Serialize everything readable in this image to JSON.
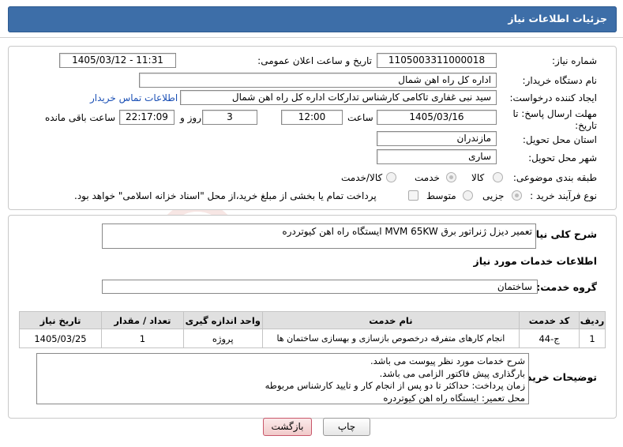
{
  "header": {
    "title": "جزئیات اطلاعات نیاز"
  },
  "form": {
    "need_number_label": "شماره نیاز:",
    "need_number": "1105003311000018",
    "announce_label": "تاریخ و ساعت اعلان عمومی:",
    "announce_value": "1405/03/12 - 11:31",
    "buyer_org_label": "نام دستگاه خریدار:",
    "buyer_org": "اداره کل راه اهن شمال",
    "creator_label": "ایجاد کننده درخواست:",
    "creator": "سید نبی غفاری تاکامی کارشناس تدارکات اداره کل راه اهن شمال",
    "buyer_contact_link": "اطلاعات تماس خریدار",
    "deadline_label": "مهلت ارسال پاسخ: تا تاریخ:",
    "deadline_date": "1405/03/16",
    "time_label": "ساعت",
    "deadline_time": "12:00",
    "days_value": "3",
    "days_label": "روز و",
    "remaining_time": "22:17:09",
    "remaining_label": "ساعت باقی مانده",
    "province_label": "استان محل تحویل:",
    "province": "مازندران",
    "city_label": "شهر محل تحویل:",
    "city": "ساری",
    "category_label": "طبقه بندی موضوعی:",
    "category_options": [
      "کالا",
      "خدمت",
      "کالا/خدمت"
    ],
    "category_selected": "خدمت",
    "purchase_type_label": "نوع فرآیند خرید :",
    "purchase_options": [
      "جزیی",
      "متوسط"
    ],
    "purchase_selected": "جزیی",
    "payment_note": "پرداخت تمام یا بخشی از مبلغ خرید،از محل \"اسناد خزانه اسلامی\" خواهد بود."
  },
  "summary": {
    "label": "شرح کلی نیاز:",
    "text": "تعمیر دیزل ژنراتور برق MVM 65KW ایستگاه راه اهن کیوتردره"
  },
  "services": {
    "section_title": "اطلاعات خدمات مورد نیاز",
    "group_label": "گروه خدمت:",
    "group_value": "ساختمان",
    "columns": [
      "ردیف",
      "کد خدمت",
      "نام خدمت",
      "واحد اندازه گیری",
      "تعداد / مقدار",
      "تاریخ نیاز"
    ],
    "rows": [
      [
        "1",
        "ج-44",
        "انجام کارهای متفرقه درخصوص بازسازی و بهسازی ساختمان ها",
        "پروژه",
        "1",
        "1405/03/25"
      ]
    ]
  },
  "buyer_notes": {
    "label": "توضیحات خریدار:",
    "lines": [
      "شرح خدمات مورد نظر پیوست می باشد.",
      "بارگذاری پیش فاکتور الزامی می باشد.",
      "زمان پرداخت: حداکثر تا دو پس از انجام کار و تایید کارشناس مربوطه",
      "محل تعمیر: ایستگاه راه اهن کیوتردره"
    ]
  },
  "buttons": {
    "print": "چاپ",
    "back": "بازگشت"
  },
  "watermark": {
    "text": "AriaTender.net"
  },
  "colors": {
    "title_bg": "#3d6ea8",
    "link": "#1a4fb5",
    "back_btn_border": "#c8566a"
  }
}
